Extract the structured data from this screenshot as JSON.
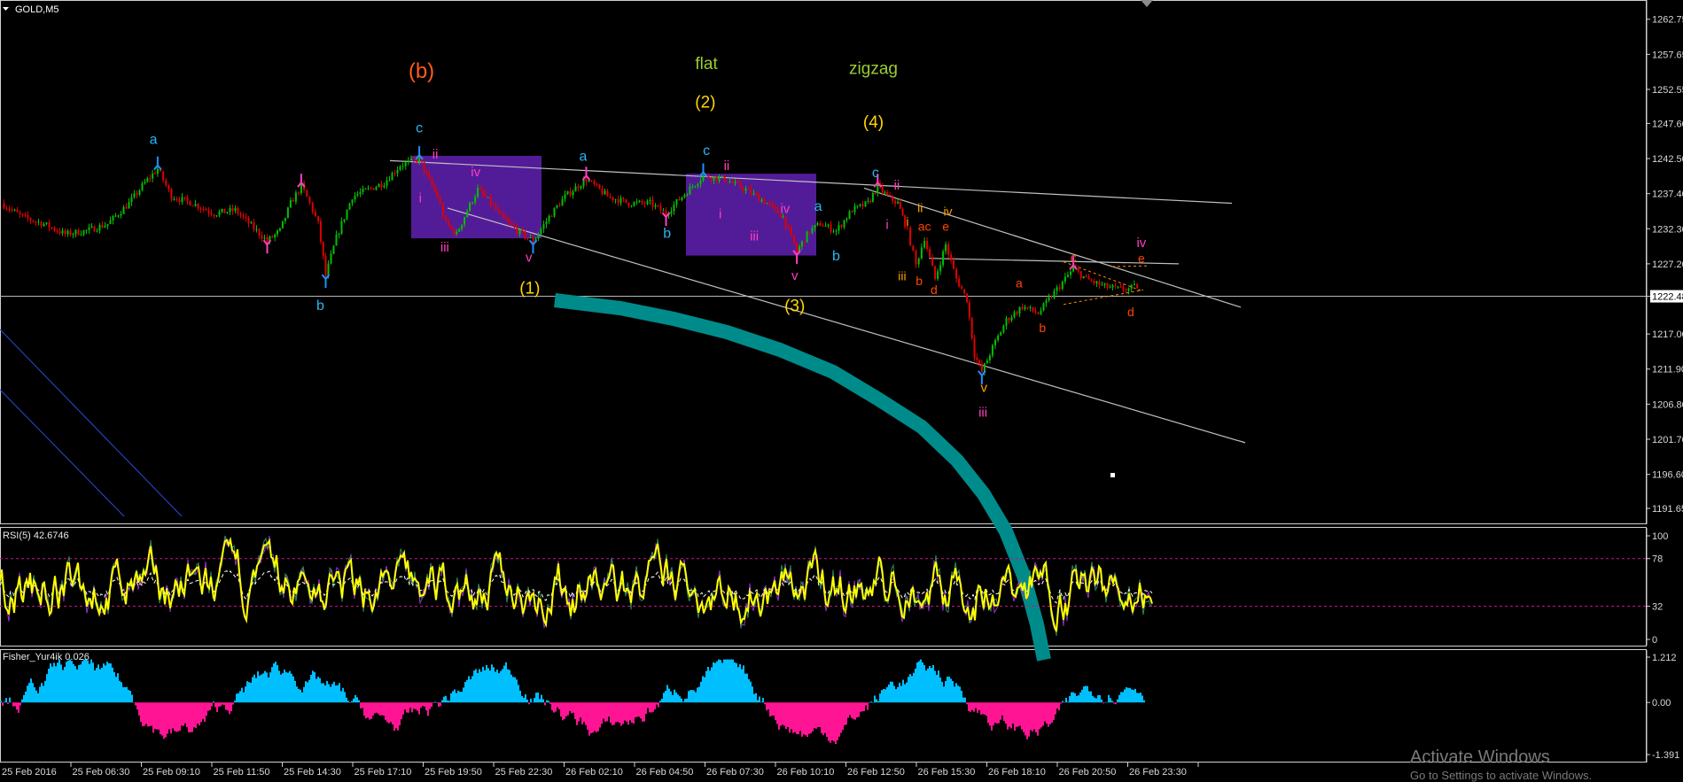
{
  "chart_data": [
    {
      "type": "line",
      "panel": "main",
      "title": "GOLD,M5",
      "y_ticks": [
        "1262.75",
        "1257.65",
        "1252.55",
        "1247.60",
        "1242.50",
        "1237.40",
        "1232.30",
        "1227.20",
        "1222.48",
        "1217.00",
        "1211.90",
        "1206.80",
        "1201.70",
        "1196.60",
        "1191.65"
      ],
      "current_price_label": "1222.48",
      "ylim": [
        1190.5,
        1264.0
      ],
      "x_ticks": [
        "25 Feb 2016",
        "25 Feb 06:30",
        "25 Feb 09:10",
        "25 Feb 11:50",
        "25 Feb 14:30",
        "25 Feb 17:10",
        "25 Feb 19:50",
        "25 Feb 22:30",
        "26 Feb 02:10",
        "26 Feb 04:50",
        "26 Feb 07:30",
        "26 Feb 10:10",
        "26 Feb 12:50",
        "26 Feb 15:30",
        "26 Feb 18:10",
        "26 Feb 20:50",
        "26 Feb 23:30"
      ],
      "price_path": [
        [
          0,
          1236
        ],
        [
          20,
          1234
        ],
        [
          40,
          1233
        ],
        [
          60,
          1231.5
        ],
        [
          80,
          1232
        ],
        [
          100,
          1233
        ],
        [
          120,
          1236
        ],
        [
          135,
          1239
        ],
        [
          147,
          1241
        ],
        [
          160,
          1237
        ],
        [
          180,
          1236
        ],
        [
          200,
          1234.5
        ],
        [
          220,
          1235
        ],
        [
          240,
          1232
        ],
        [
          250,
          1230.5
        ],
        [
          262,
          1232
        ],
        [
          272,
          1236
        ],
        [
          282,
          1238.5
        ],
        [
          290,
          1236
        ],
        [
          298,
          1233
        ],
        [
          305,
          1225.5
        ],
        [
          315,
          1231
        ],
        [
          330,
          1237
        ],
        [
          345,
          1238
        ],
        [
          360,
          1239
        ],
        [
          375,
          1241.5
        ],
        [
          393,
          1242.5
        ],
        [
          400,
          1240
        ],
        [
          410,
          1237
        ],
        [
          418,
          1233
        ],
        [
          428,
          1231.5
        ],
        [
          438,
          1235
        ],
        [
          448,
          1238
        ],
        [
          460,
          1236
        ],
        [
          470,
          1234
        ],
        [
          485,
          1232
        ],
        [
          500,
          1230.5
        ],
        [
          515,
          1234
        ],
        [
          530,
          1237
        ],
        [
          550,
          1239.5
        ],
        [
          570,
          1237
        ],
        [
          590,
          1236
        ],
        [
          610,
          1236
        ],
        [
          625,
          1234.5
        ],
        [
          640,
          1237
        ],
        [
          660,
          1240
        ],
        [
          680,
          1239.5
        ],
        [
          700,
          1238
        ],
        [
          720,
          1236
        ],
        [
          735,
          1234
        ],
        [
          748,
          1229
        ],
        [
          760,
          1232
        ],
        [
          770,
          1233
        ],
        [
          785,
          1232
        ],
        [
          800,
          1235
        ],
        [
          815,
          1236
        ],
        [
          824,
          1238.5
        ],
        [
          833,
          1237
        ],
        [
          843,
          1236
        ],
        [
          852,
          1232
        ],
        [
          860,
          1227
        ],
        [
          868,
          1231
        ],
        [
          878,
          1225
        ],
        [
          888,
          1230
        ],
        [
          898,
          1225
        ],
        [
          908,
          1222
        ],
        [
          915,
          1214
        ],
        [
          922,
          1211.5
        ],
        [
          932,
          1215
        ],
        [
          945,
          1219
        ],
        [
          960,
          1221
        ],
        [
          975,
          1220
        ],
        [
          990,
          1223
        ],
        [
          1008,
          1226.5
        ],
        [
          1020,
          1225
        ],
        [
          1035,
          1224
        ],
        [
          1050,
          1223.5
        ],
        [
          1060,
          1223.5
        ],
        [
          1068,
          1224
        ]
      ],
      "annotations": [
        {
          "text": "(b)",
          "color": "#ff5a1f",
          "price": 1254.2,
          "xi": 395,
          "size": 24
        },
        {
          "text": "flat",
          "color": "#9acd32",
          "price": 1255.5,
          "xi": 663,
          "size": 19
        },
        {
          "text": "(2)",
          "color": "#ffd700",
          "price": 1249.9,
          "xi": 662,
          "size": 19
        },
        {
          "text": "zigzag",
          "color": "#9acd32",
          "price": 1254.8,
          "xi": 820,
          "size": 19
        },
        {
          "text": "(4)",
          "color": "#ffd700",
          "price": 1247.0,
          "xi": 820,
          "size": 19
        },
        {
          "text": "(1)",
          "color": "#ffd700",
          "price": 1222.9,
          "xi": 497,
          "size": 19
        },
        {
          "text": "(3)",
          "color": "#ffd700",
          "price": 1220.3,
          "xi": 746,
          "size": 19
        },
        {
          "text": "a",
          "color": "#29b6f6",
          "price": 1244.6,
          "xi": 143,
          "size": 16
        },
        {
          "text": "b",
          "color": "#29b6f6",
          "price": 1220.5,
          "xi": 300,
          "size": 16
        },
        {
          "text": "c",
          "color": "#29b6f6",
          "price": 1246.3,
          "xi": 393,
          "size": 16
        },
        {
          "text": "ii",
          "color": "#ff3fbf",
          "price": 1242.5,
          "xi": 408,
          "size": 15
        },
        {
          "text": "iv",
          "color": "#ff3fbf",
          "price": 1239.9,
          "xi": 446,
          "size": 15
        },
        {
          "text": "i",
          "color": "#ff3fbf",
          "price": 1236.1,
          "xi": 394,
          "size": 15
        },
        {
          "text": "iii",
          "color": "#ff3fbf",
          "price": 1229.0,
          "xi": 417,
          "size": 15
        },
        {
          "text": "v",
          "color": "#ff3fbf",
          "price": 1227.5,
          "xi": 496,
          "size": 15
        },
        {
          "text": "a",
          "color": "#29b6f6",
          "price": 1242.2,
          "xi": 547,
          "size": 16
        },
        {
          "text": "b",
          "color": "#29b6f6",
          "price": 1231.0,
          "xi": 626,
          "size": 16
        },
        {
          "text": "c",
          "color": "#29b6f6",
          "price": 1243.0,
          "xi": 663,
          "size": 16
        },
        {
          "text": "ii",
          "color": "#ff3fbf",
          "price": 1240.8,
          "xi": 682,
          "size": 15
        },
        {
          "text": "i",
          "color": "#ff3fbf",
          "price": 1233.8,
          "xi": 676,
          "size": 15
        },
        {
          "text": "iv",
          "color": "#ff3fbf",
          "price": 1234.6,
          "xi": 737,
          "size": 15
        },
        {
          "text": "iii",
          "color": "#ff3fbf",
          "price": 1230.6,
          "xi": 708,
          "size": 15
        },
        {
          "text": "a",
          "color": "#29b6f6",
          "price": 1234.9,
          "xi": 768,
          "size": 16
        },
        {
          "text": "b",
          "color": "#29b6f6",
          "price": 1227.7,
          "xi": 785,
          "size": 16
        },
        {
          "text": "v",
          "color": "#ff3fbf",
          "price": 1224.9,
          "xi": 746,
          "size": 15
        },
        {
          "text": "c",
          "color": "#29b6f6",
          "price": 1239.8,
          "xi": 822,
          "size": 16
        },
        {
          "text": "ii",
          "color": "#ff3fbf",
          "price": 1238.0,
          "xi": 842,
          "size": 15
        },
        {
          "text": "i",
          "color": "#ff3fbf",
          "price": 1232.3,
          "xi": 833,
          "size": 15
        },
        {
          "text": "ii",
          "color": "#ffa500",
          "price": 1234.7,
          "xi": 864,
          "size": 14
        },
        {
          "text": "i",
          "color": "#ffa500",
          "price": 1232.7,
          "xi": 852,
          "size": 14
        },
        {
          "text": "ac",
          "color": "#ff4500",
          "price": 1232.0,
          "xi": 868,
          "size": 14
        },
        {
          "text": "e",
          "color": "#ff4500",
          "price": 1232.0,
          "xi": 888,
          "size": 14
        },
        {
          "text": "iv",
          "color": "#ffa500",
          "price": 1234.2,
          "xi": 890,
          "size": 14
        },
        {
          "text": "iii",
          "color": "#ffa500",
          "price": 1224.8,
          "xi": 847,
          "size": 14
        },
        {
          "text": "b",
          "color": "#ff4500",
          "price": 1224.1,
          "xi": 863,
          "size": 14
        },
        {
          "text": "d",
          "color": "#ff4500",
          "price": 1222.8,
          "xi": 877,
          "size": 14
        },
        {
          "text": "iv",
          "color": "#ff3fbf",
          "price": 1229.6,
          "xi": 1072,
          "size": 15
        },
        {
          "text": "e",
          "color": "#ff4500",
          "price": 1227.4,
          "xi": 1072,
          "size": 14
        },
        {
          "text": "c",
          "color": "#ff4500",
          "price": 1227.5,
          "xi": 1008,
          "size": 14
        },
        {
          "text": "a",
          "color": "#ff4500",
          "price": 1223.8,
          "xi": 957,
          "size": 14
        },
        {
          "text": "b",
          "color": "#ff4500",
          "price": 1217.3,
          "xi": 979,
          "size": 14
        },
        {
          "text": "d",
          "color": "#ff4500",
          "price": 1219.6,
          "xi": 1062,
          "size": 14
        },
        {
          "text": "v",
          "color": "#ffa500",
          "price": 1208.6,
          "xi": 924,
          "size": 15
        },
        {
          "text": "iii",
          "color": "#ff3fbf",
          "price": 1205.0,
          "xi": 923,
          "size": 15
        }
      ]
    },
    {
      "type": "line",
      "panel": "RSI",
      "title": "RSI(5) 42.6746",
      "ylim": [
        0,
        100
      ],
      "levels": [
        78,
        32
      ],
      "y_ticks": [
        "100",
        "78",
        "32",
        "0"
      ]
    },
    {
      "type": "bar",
      "panel": "Fisher",
      "title": "Fisher_Yur4ik 0.026",
      "ylim": [
        -1.391,
        1.212
      ],
      "y_ticks": [
        "1.212",
        "0.00",
        "-1.391"
      ]
    }
  ],
  "watermark": {
    "line1": "Activate Windows",
    "line2": "Go to Settings to activate Windows."
  }
}
